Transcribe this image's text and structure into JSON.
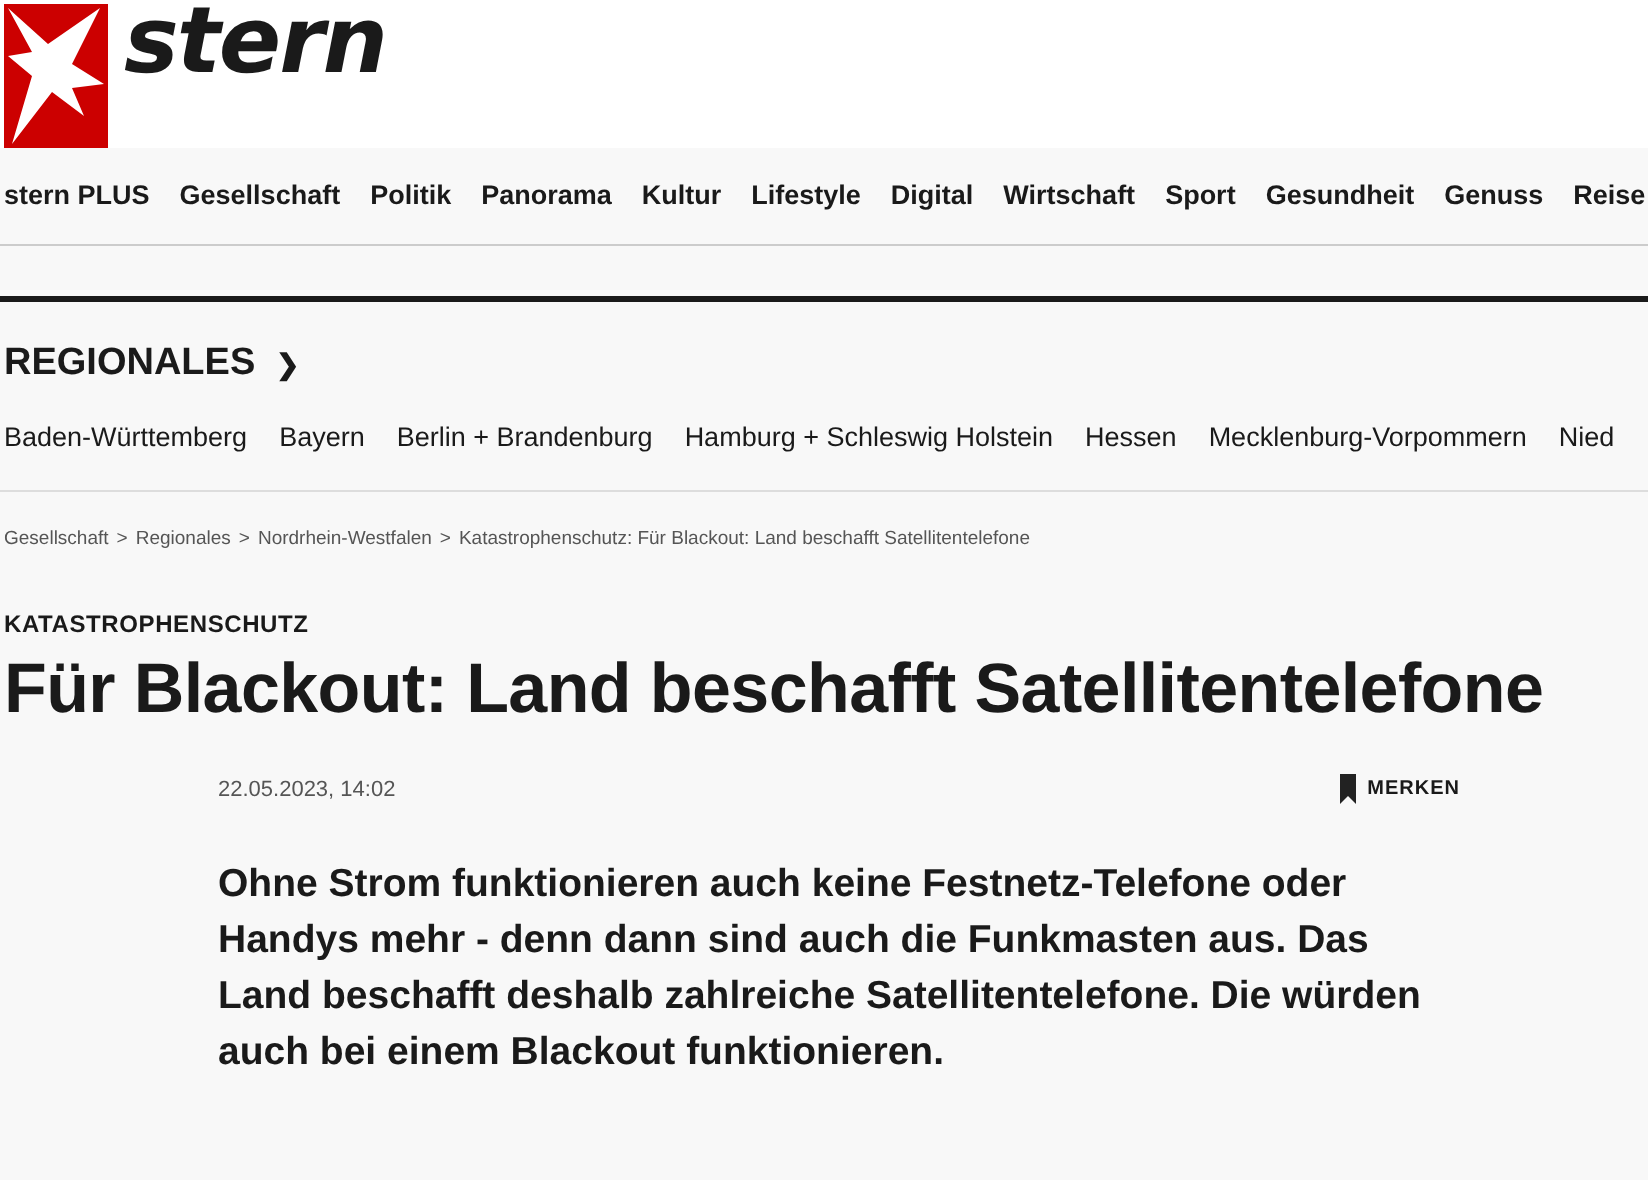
{
  "logo": {
    "wordmark": "stern"
  },
  "main_nav": [
    {
      "label": "stern PLUS"
    },
    {
      "label": "Gesellschaft"
    },
    {
      "label": "Politik"
    },
    {
      "label": "Panorama"
    },
    {
      "label": "Kultur"
    },
    {
      "label": "Lifestyle"
    },
    {
      "label": "Digital"
    },
    {
      "label": "Wirtschaft"
    },
    {
      "label": "Sport"
    },
    {
      "label": "Gesundheit"
    },
    {
      "label": "Genuss"
    },
    {
      "label": "Reise"
    }
  ],
  "section": {
    "title": "REGIONALES",
    "chevron": "❯"
  },
  "regions": [
    {
      "label": "Baden-Württemberg"
    },
    {
      "label": "Bayern"
    },
    {
      "label": "Berlin + Brandenburg"
    },
    {
      "label": "Hamburg + Schleswig Holstein"
    },
    {
      "label": "Hessen"
    },
    {
      "label": "Mecklenburg-Vorpommern"
    },
    {
      "label": "Nied"
    }
  ],
  "breadcrumb": [
    {
      "label": "Gesellschaft"
    },
    {
      "label": "Regionales"
    },
    {
      "label": "Nordrhein-Westfalen"
    },
    {
      "label": "Katastrophenschutz: Für Blackout: Land beschafft Satellitentelefone"
    }
  ],
  "breadcrumb_separator": ">",
  "article": {
    "kicker": "KATASTROPHENSCHUTZ",
    "headline": "Für Blackout: Land beschafft Satellitentelefone",
    "date": "22.05.2023, 14:02",
    "bookmark_label": "MERKEN",
    "lead": "Ohne Strom funktionieren auch keine Festnetz-Telefone oder Handys mehr - denn dann sind auch die Funkmasten aus. Das Land beschafft deshalb zahlreiche Satellitentelefone. Die würden auch bei einem Blackout funktionieren."
  }
}
